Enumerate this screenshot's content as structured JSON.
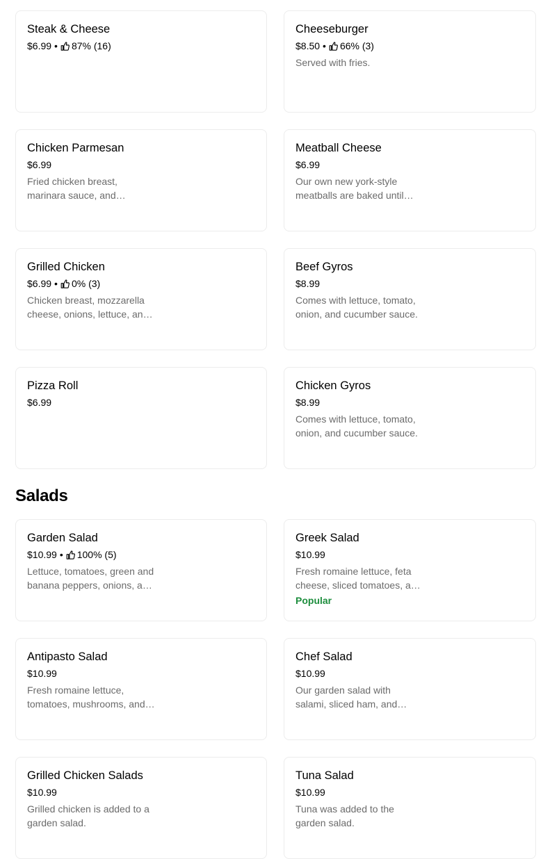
{
  "sections": [
    {
      "items": [
        {
          "name": "Steak & Cheese",
          "price": "$6.99",
          "rating": "87% (16)",
          "desc": ""
        },
        {
          "name": "Cheeseburger",
          "price": "$8.50",
          "rating": "66% (3)",
          "desc": "Served with fries."
        },
        {
          "name": "Chicken Parmesan",
          "price": "$6.99",
          "rating": "",
          "desc": "Fried chicken breast, marinara sauce, and provolone cheese."
        },
        {
          "name": "Meatball Cheese",
          "price": "$6.99",
          "rating": "",
          "desc": "Our own new york-style meatballs are baked until golden brown."
        },
        {
          "name": "Grilled Chicken",
          "price": "$6.99",
          "rating": "0% (3)",
          "desc": "Chicken breast, mozzarella cheese, onions, lettuce, and tomato."
        },
        {
          "name": "Beef Gyros",
          "price": "$8.99",
          "rating": "",
          "desc": "Comes with lettuce, tomato, onion, and cucumber sauce."
        },
        {
          "name": "Pizza Roll",
          "price": "$6.99",
          "rating": "",
          "desc": ""
        },
        {
          "name": "Chicken Gyros",
          "price": "$8.99",
          "rating": "",
          "desc": "Comes with lettuce, tomato, onion, and cucumber sauce."
        }
      ]
    },
    {
      "title": "Salads",
      "items": [
        {
          "name": "Garden Salad",
          "price": "$10.99",
          "rating": "100% (5)",
          "desc": "Lettuce, tomatoes, green and banana peppers, onions, and olives."
        },
        {
          "name": "Greek Salad",
          "price": "$10.99",
          "rating": "",
          "desc": "Fresh romaine lettuce, feta cheese, sliced tomatoes, and olives.",
          "tag": "Popular"
        },
        {
          "name": "Antipasto Salad",
          "price": "$10.99",
          "rating": "",
          "desc": "Fresh romaine lettuce, tomatoes, mushrooms, and salami."
        },
        {
          "name": "Chef Salad",
          "price": "$10.99",
          "rating": "",
          "desc": "Our garden salad with salami, sliced ham, and cheese."
        },
        {
          "name": "Grilled Chicken Salads",
          "price": "$10.99",
          "rating": "",
          "desc": "Grilled chicken is added to a garden salad."
        },
        {
          "name": "Tuna Salad",
          "price": "$10.99",
          "rating": "",
          "desc": "Tuna was added to the garden salad."
        }
      ]
    }
  ],
  "colors": {
    "accent_green": "#1e8e3e",
    "muted_text": "#6b6b6b",
    "card_border": "#ececec"
  },
  "icons": {
    "rating": "thumbs-up-icon"
  }
}
